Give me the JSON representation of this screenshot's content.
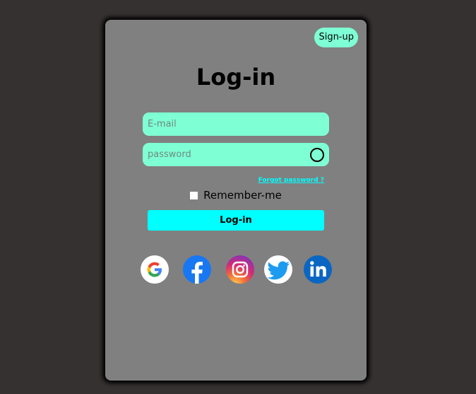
{
  "header": {
    "signup_label": "Sign-up"
  },
  "form": {
    "title": "Log-in",
    "email_placeholder": "E-mail",
    "password_placeholder": "password",
    "forgot_label": "Forgot password ?",
    "remember_label": "Remember-me",
    "remember_checked": false,
    "submit_label": "Log-in"
  },
  "socials": [
    {
      "name": "google",
      "icon": "google-icon"
    },
    {
      "name": "facebook",
      "icon": "facebook-icon"
    },
    {
      "name": "instagram",
      "icon": "instagram-icon"
    },
    {
      "name": "twitter",
      "icon": "twitter-icon"
    },
    {
      "name": "linkedin",
      "icon": "linkedin-icon"
    }
  ],
  "colors": {
    "background": "#363131",
    "card": "#808080",
    "field": "#7fffd4",
    "accent": "#00ffff"
  }
}
